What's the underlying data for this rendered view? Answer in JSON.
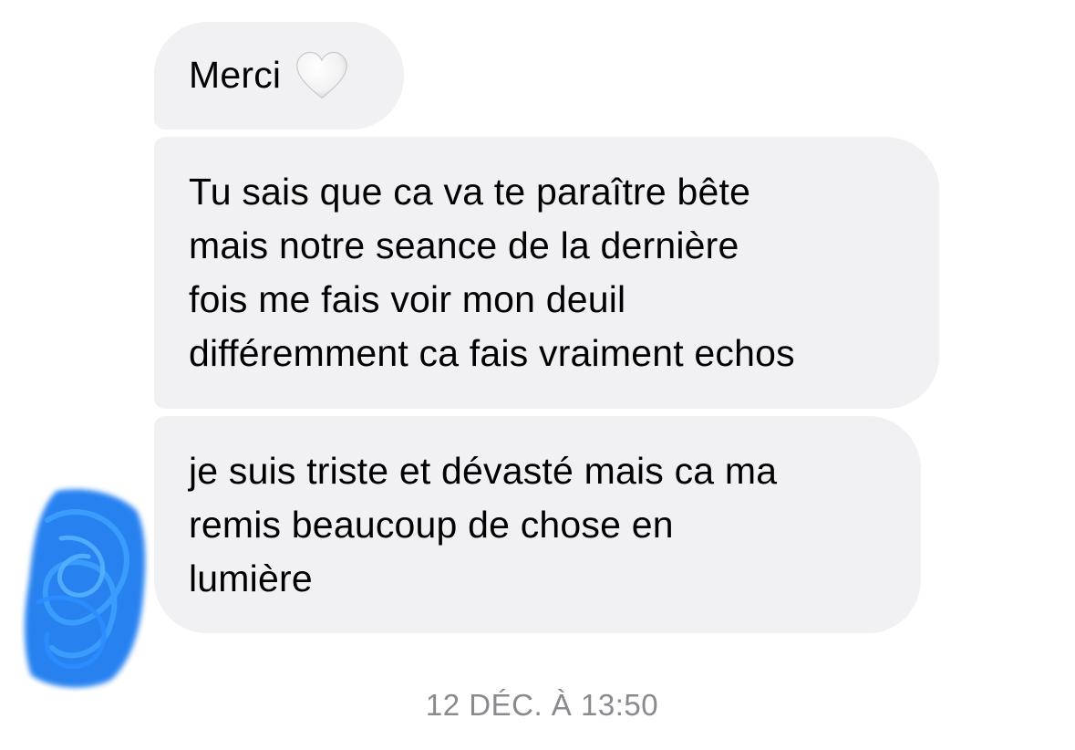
{
  "conversation": {
    "messages": [
      {
        "text": "Merci",
        "emoji": "white-heart"
      },
      {
        "text": "Tu sais que ca va te paraître bête\nmais notre seance de la dernière\nfois me fais voir mon deuil\ndifféremment ca fais vraiment echos"
      },
      {
        "text": "je suis triste et dévasté mais ca ma\nremis beaucoup de chose en\nlumière"
      }
    ],
    "timestamp": "12 DÉC. À 13:50"
  },
  "colors": {
    "bubble_background": "#f1f1f3",
    "timestamp_text": "#8a8a8e",
    "avatar_scribble": "#1e7cf0"
  }
}
